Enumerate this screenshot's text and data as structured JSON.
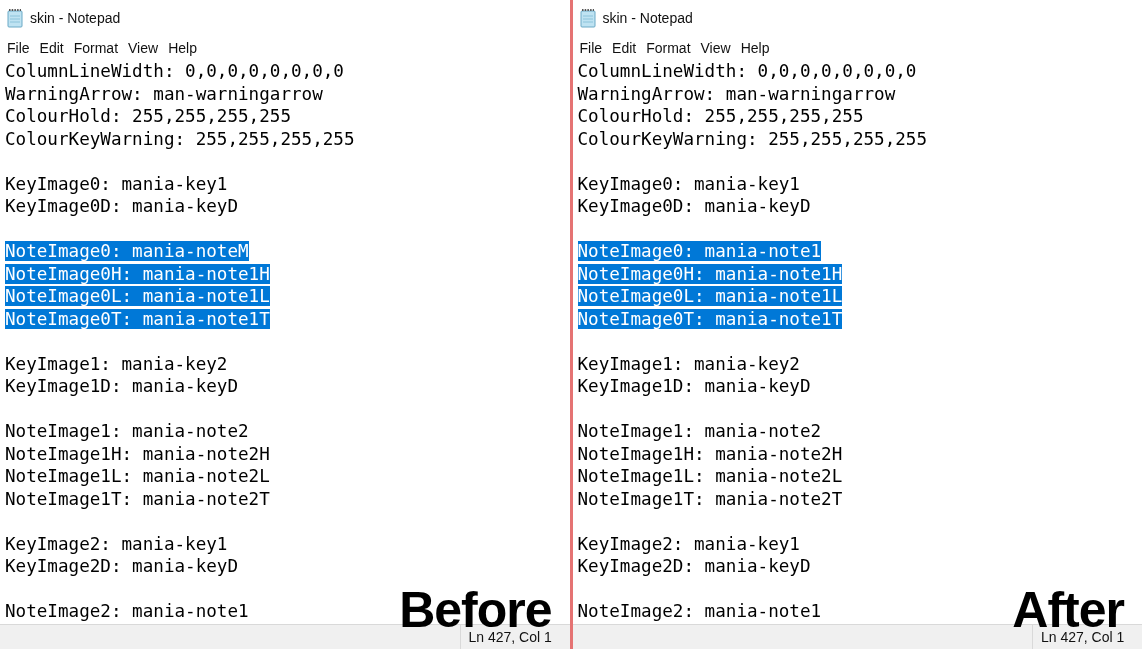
{
  "panes": [
    {
      "window": {
        "title": "skin - Notepad"
      },
      "menu": [
        "File",
        "Edit",
        "Format",
        "View",
        "Help"
      ],
      "blocks": [
        [
          {
            "text": "ColumnLineWidth: 0,0,0,0,0,0,0,0",
            "selected": false
          },
          {
            "text": "WarningArrow: man-warningarrow",
            "selected": false
          },
          {
            "text": "ColourHold: 255,255,255,255",
            "selected": false
          },
          {
            "text": "ColourKeyWarning: 255,255,255,255",
            "selected": false
          }
        ],
        [
          {
            "text": "KeyImage0: mania-key1",
            "selected": false
          },
          {
            "text": "KeyImage0D: mania-keyD",
            "selected": false
          }
        ],
        [
          {
            "text": "NoteImage0: mania-noteM",
            "selected": true
          },
          {
            "text": "NoteImage0H: mania-note1H",
            "selected": true
          },
          {
            "text": "NoteImage0L: mania-note1L",
            "selected": true
          },
          {
            "text": "NoteImage0T: mania-note1T",
            "selected": true
          }
        ],
        [
          {
            "text": "KeyImage1: mania-key2",
            "selected": false
          },
          {
            "text": "KeyImage1D: mania-keyD",
            "selected": false
          }
        ],
        [
          {
            "text": "NoteImage1: mania-note2",
            "selected": false
          },
          {
            "text": "NoteImage1H: mania-note2H",
            "selected": false
          },
          {
            "text": "NoteImage1L: mania-note2L",
            "selected": false
          },
          {
            "text": "NoteImage1T: mania-note2T",
            "selected": false
          }
        ],
        [
          {
            "text": "KeyImage2: mania-key1",
            "selected": false
          },
          {
            "text": "KeyImage2D: mania-keyD",
            "selected": false
          }
        ],
        [
          {
            "text": "NoteImage2: mania-note1",
            "selected": false
          }
        ]
      ],
      "status": "Ln 427, Col 1",
      "caption": "Before"
    },
    {
      "window": {
        "title": "skin - Notepad"
      },
      "menu": [
        "File",
        "Edit",
        "Format",
        "View",
        "Help"
      ],
      "blocks": [
        [
          {
            "text": "ColumnLineWidth: 0,0,0,0,0,0,0,0",
            "selected": false
          },
          {
            "text": "WarningArrow: man-warningarrow",
            "selected": false
          },
          {
            "text": "ColourHold: 255,255,255,255",
            "selected": false
          },
          {
            "text": "ColourKeyWarning: 255,255,255,255",
            "selected": false
          }
        ],
        [
          {
            "text": "KeyImage0: mania-key1",
            "selected": false
          },
          {
            "text": "KeyImage0D: mania-keyD",
            "selected": false
          }
        ],
        [
          {
            "text": "NoteImage0: mania-note1",
            "selected": true
          },
          {
            "text": "NoteImage0H: mania-note1H",
            "selected": true
          },
          {
            "text": "NoteImage0L: mania-note1L",
            "selected": true
          },
          {
            "text": "NoteImage0T: mania-note1T",
            "selected": true
          }
        ],
        [
          {
            "text": "KeyImage1: mania-key2",
            "selected": false
          },
          {
            "text": "KeyImage1D: mania-keyD",
            "selected": false
          }
        ],
        [
          {
            "text": "NoteImage1: mania-note2",
            "selected": false
          },
          {
            "text": "NoteImage1H: mania-note2H",
            "selected": false
          },
          {
            "text": "NoteImage1L: mania-note2L",
            "selected": false
          },
          {
            "text": "NoteImage1T: mania-note2T",
            "selected": false
          }
        ],
        [
          {
            "text": "KeyImage2: mania-key1",
            "selected": false
          },
          {
            "text": "KeyImage2D: mania-keyD",
            "selected": false
          }
        ],
        [
          {
            "text": "NoteImage2: mania-note1",
            "selected": false
          }
        ]
      ],
      "status": "Ln 427, Col 1",
      "caption": "After"
    }
  ]
}
